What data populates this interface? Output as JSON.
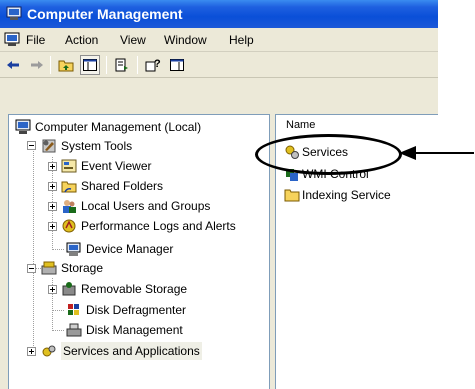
{
  "window": {
    "title": "Computer Management"
  },
  "menubar": {
    "items": [
      "File",
      "Action",
      "View",
      "Window",
      "Help"
    ]
  },
  "toolbar": {
    "buttons": [
      "back-arrow-icon",
      "forward-arrow-icon",
      "up-folder-icon",
      "show-hide-tree-icon",
      "export-list-icon",
      "help-icon",
      "action-pane-icon"
    ]
  },
  "tree": {
    "root": "Computer Management (Local)",
    "items": [
      {
        "label": "System Tools",
        "icon": "tools-icon"
      },
      {
        "label": "Event Viewer",
        "icon": "event-viewer-icon"
      },
      {
        "label": "Shared Folders",
        "icon": "shared-folder-icon"
      },
      {
        "label": "Local Users and Groups",
        "icon": "users-icon"
      },
      {
        "label": "Performance Logs and Alerts",
        "icon": "performance-icon"
      },
      {
        "label": "Device Manager",
        "icon": "device-manager-icon"
      },
      {
        "label": "Storage",
        "icon": "storage-icon"
      },
      {
        "label": "Removable Storage",
        "icon": "removable-storage-icon"
      },
      {
        "label": "Disk Defragmenter",
        "icon": "defrag-icon"
      },
      {
        "label": "Disk Management",
        "icon": "disk-management-icon"
      },
      {
        "label": "Services and Applications",
        "icon": "services-apps-icon"
      }
    ]
  },
  "list": {
    "column_name": "Name",
    "items": [
      {
        "label": "Services",
        "icon": "services-icon"
      },
      {
        "label": "WMI Control",
        "icon": "wmi-icon"
      },
      {
        "label": "Indexing Service",
        "icon": "folder-icon"
      }
    ]
  },
  "colors": {
    "titlebar": "#0a4fd8",
    "chrome": "#ece9d8",
    "pane_border": "#7f9db9"
  }
}
